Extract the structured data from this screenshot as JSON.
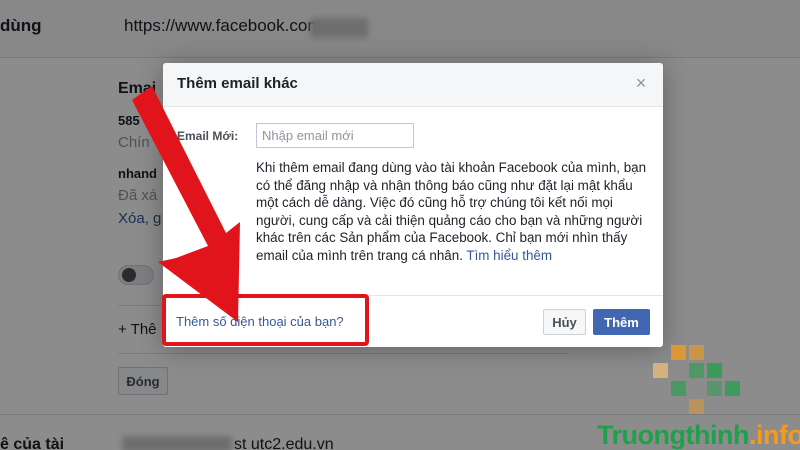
{
  "background": {
    "label_dung": "dùng",
    "url": "https://www.facebook.com",
    "email_heading": "Emai",
    "entry1_id": "585",
    "entry1_status": "Chín",
    "entry2_name": "nhand",
    "entry2_status": "Đã xá",
    "entry2_link": "Xóa, g",
    "add_more": "+ Thê",
    "close_button": "Đóng",
    "bottom_label": "ệ của tài",
    "bottom_value": "st utc2.edu.vn"
  },
  "dialog": {
    "title": "Thêm email khác",
    "close_symbol": "×",
    "email_label": "Email Mới:",
    "email_placeholder": "Nhập email mới",
    "email_value": "",
    "info_text": "Khi thêm email đang dùng vào tài khoản Facebook của mình, bạn có thể đăng nhập và nhận thông báo cũng như đặt lại mật khẩu một cách dễ dàng. Việc đó cũng hỗ trợ chúng tôi kết nối mọi người, cung cấp và cải thiện quảng cáo cho bạn và những người khác trên các Sản phẩm của Facebook. Chỉ bạn mới nhìn thấy email của mình trên trang cá nhân.",
    "learn_more": "Tìm hiểu thêm",
    "phone_link": "Thêm số điện thoại của bạn?",
    "cancel_label": "Hủy",
    "add_label": "Thêm"
  },
  "watermark": {
    "main": "Truongthinh",
    "suffix": ".info"
  },
  "icons": {
    "dialog_close": "close-icon",
    "annotation_arrow": "red-arrow-icon",
    "watermark_logo": "pixel-logo-icon"
  },
  "colors": {
    "link": "#365899",
    "primary_button": "#4267b2",
    "annotation_red": "#e2141b",
    "watermark_green": "#1fa04a",
    "watermark_orange": "#f39a1f"
  }
}
